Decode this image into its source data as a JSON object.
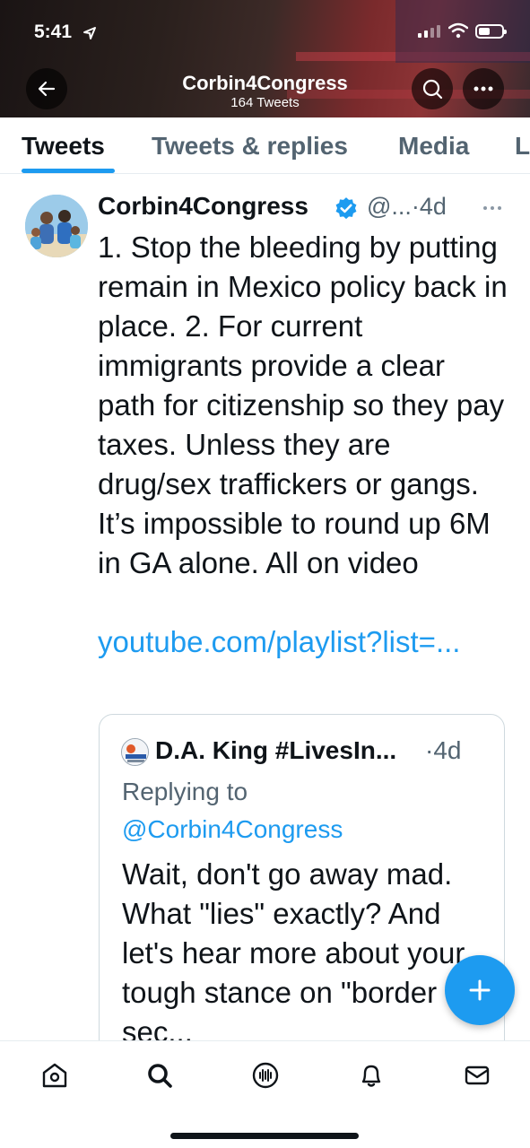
{
  "status_bar": {
    "time": "5:41"
  },
  "header": {
    "title": "Corbin4Congress",
    "subtitle": "164 Tweets"
  },
  "tabs": [
    {
      "label": "Tweets",
      "active": true
    },
    {
      "label": "Tweets & replies",
      "active": false
    },
    {
      "label": "Media",
      "active": false
    },
    {
      "label": "L",
      "active": false
    }
  ],
  "tweet": {
    "author": "Corbin4Congress",
    "handle": "@...",
    "time": "·4d",
    "text": "1. Stop the bleeding by putting remain in Mexico policy back in place. 2. For current immigrants provide a clear path for citizenship so they pay taxes. Unless they are drug/sex traffickers or gangs. It’s impossible to round up 6M in GA alone. All on video",
    "link": "youtube.com/playlist?list=...",
    "quote": {
      "author": "D.A. King #LivesIn...",
      "time": "·4d",
      "replying_to_label": "Replying to",
      "replying_to_handle": "@Corbin4Congress",
      "text": "Wait, don't go away mad. What \"lies\" exactly? And let's hear more about your tough stance on \"border sec..."
    }
  },
  "colors": {
    "accent": "#1d9bf0",
    "text": "#0f1419",
    "secondary": "#536471"
  },
  "icons": [
    "back-arrow-icon",
    "search-icon",
    "more-icon",
    "verified-icon",
    "compose-plus-icon",
    "home-icon",
    "explore-search-icon",
    "spaces-icon",
    "notifications-bell-icon",
    "messages-mail-icon"
  ]
}
